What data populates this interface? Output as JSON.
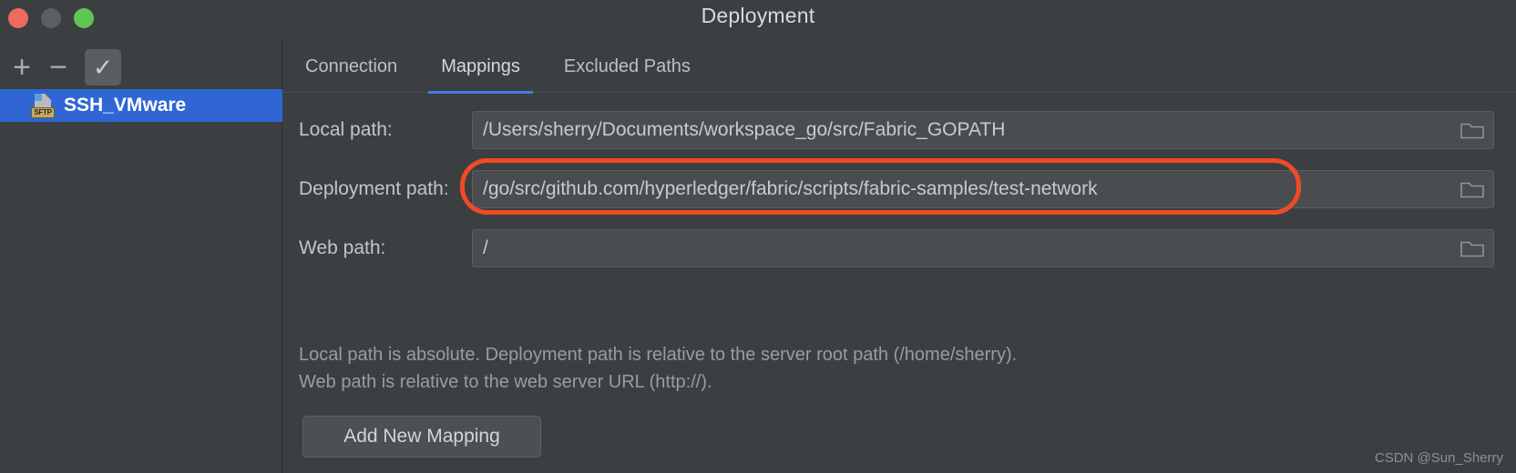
{
  "window": {
    "title": "Deployment",
    "traffic_lights": [
      {
        "name": "close",
        "color": "#ed6a5e"
      },
      {
        "name": "minimize",
        "color": "#5c5f61"
      },
      {
        "name": "maximize",
        "color": "#61c554"
      }
    ]
  },
  "sidebar": {
    "toolbar": {
      "add_label": "+",
      "remove_label": "−",
      "toggle_label": "✓"
    },
    "items": [
      {
        "label": "SSH_VMware",
        "icon": "sftp-server-icon",
        "badge": "SFTP",
        "selected": true
      }
    ]
  },
  "main": {
    "tabs": [
      {
        "label": "Connection",
        "active": false
      },
      {
        "label": "Mappings",
        "active": true
      },
      {
        "label": "Excluded Paths",
        "active": false
      }
    ],
    "fields": [
      {
        "label": "Local path:",
        "value": "/Users/sherry/Documents/workspace_go/src/Fabric_GOPATH",
        "browse_icon": "folder-icon"
      },
      {
        "label": "Deployment path:",
        "value": "/go/src/github.com/hyperledger/fabric/scripts/fabric-samples/test-network",
        "browse_icon": "folder-icon",
        "highlighted": true
      },
      {
        "label": "Web path:",
        "value": "/",
        "browse_icon": "folder-icon"
      }
    ],
    "hints": [
      "Local path is absolute. Deployment path is relative to the server root path (/home/sherry).",
      "Web path is relative to the web server URL (http://)."
    ],
    "add_mapping_label": "Add New Mapping"
  },
  "watermark": "CSDN @Sun_Sherry",
  "colors": {
    "background": "#3c3f41",
    "selection": "#2f66d4",
    "tab_accent": "#3f7fe0",
    "annotation": "#f04a26",
    "field_background": "#4a4d4f"
  }
}
